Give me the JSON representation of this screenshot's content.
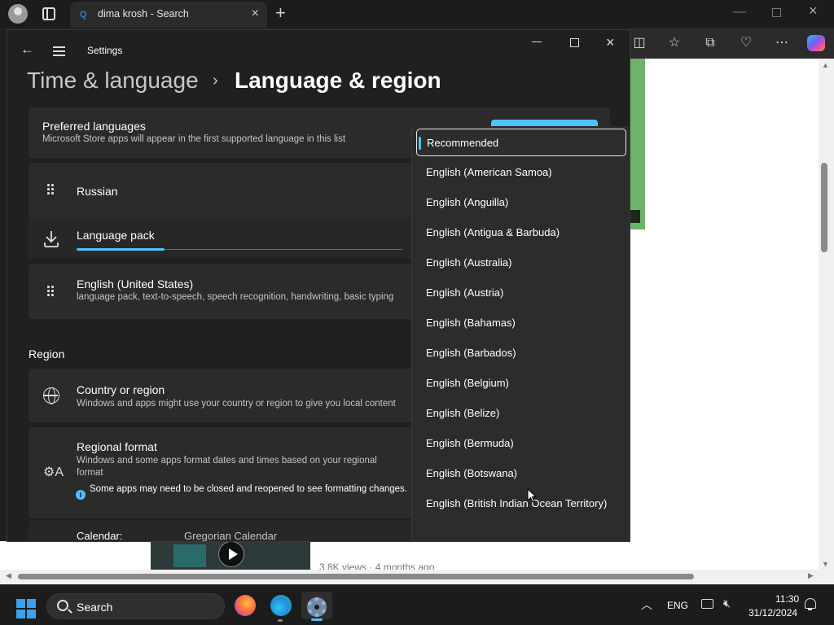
{
  "browser": {
    "tab_title": "dima krosh - Search",
    "tab_favicon": "Q",
    "toolbar_icons": [
      "split-screen-icon",
      "favorites-icon",
      "collections-icon",
      "browser-essentials-icon",
      "more-icon",
      "copilot-icon"
    ]
  },
  "web_page": {
    "video_meta": "3.8K views · 4 months ago"
  },
  "settings": {
    "window_title": "Settings",
    "breadcrumb_parent": "Time & language",
    "breadcrumb_separator": "›",
    "breadcrumb_current": "Language & region",
    "preferred": {
      "title": "Preferred languages",
      "subtitle": "Microsoft Store apps will appear in the first supported language in this list"
    },
    "languages": [
      {
        "name": "Russian"
      },
      {
        "name": "English (United States)",
        "detail": "language pack, text-to-speech, speech recognition, handwriting, basic typing"
      }
    ],
    "language_pack": {
      "label": "Language pack",
      "progress": 0.27
    },
    "region_heading": "Region",
    "country": {
      "title": "Country or region",
      "subtitle": "Windows and apps might use your country or region to give you local content"
    },
    "regional_format": {
      "title": "Regional format",
      "subtitle": "Windows and some apps format dates and times based on your regional format",
      "note": "Some apps may need to be closed and reopened to see formatting changes."
    },
    "calendar": {
      "label": "Calendar:",
      "value": "Gregorian Calendar"
    }
  },
  "dropdown": {
    "selected_index": 0,
    "items": [
      "Recommended",
      "English (American Samoa)",
      "English (Anguilla)",
      "English (Antigua & Barbuda)",
      "English (Australia)",
      "English (Austria)",
      "English (Bahamas)",
      "English (Barbados)",
      "English (Belgium)",
      "English (Belize)",
      "English (Bermuda)",
      "English (Botswana)",
      "English (British Indian Ocean Territory)"
    ]
  },
  "taskbar": {
    "search_label": "Search",
    "language": "ENG",
    "time": "11:30",
    "date": "31/12/2024"
  },
  "colors": {
    "accent": "#4cc2ff",
    "card": "#2b2b2b",
    "window": "#202020"
  }
}
